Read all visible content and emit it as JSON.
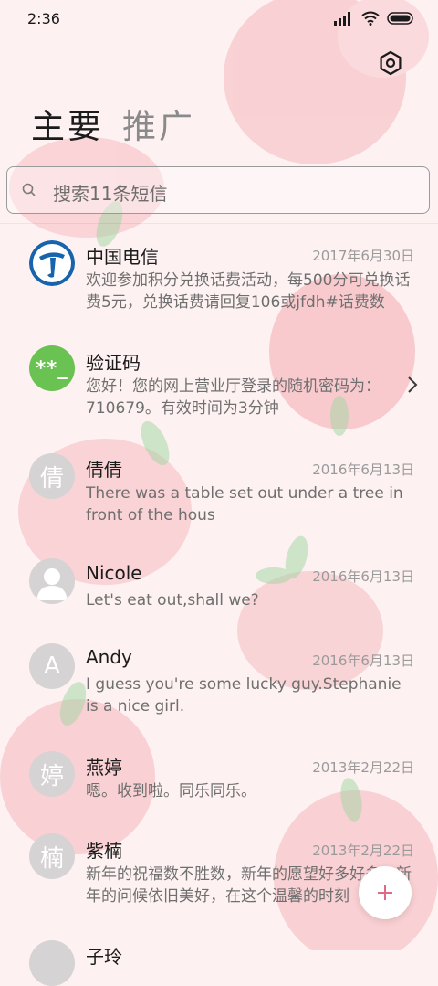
{
  "status": {
    "time": "2:36"
  },
  "tabs": [
    {
      "label": "主要",
      "active": true
    },
    {
      "label": "推广",
      "active": false
    }
  ],
  "search": {
    "placeholder": "搜索11条短信"
  },
  "conversations": [
    {
      "name": "中国电信",
      "date": "2017年6月30日",
      "preview": "欢迎参加积分兑换话费活动，每500分可兑换话费5元，兑换话费请回复106或jfdh#话费数",
      "avatar": "china-telecom-logo"
    },
    {
      "name": "验证码",
      "date": "",
      "preview": "您好！您的网上营业厅登录的随机密码为：710679。有效时间为3分钟",
      "avatar_text": "**_"
    },
    {
      "name": "倩倩",
      "date": "2016年6月13日",
      "preview": "There was a table set out under a tree in front of the hous",
      "avatar_text": "倩"
    },
    {
      "name": "Nicole",
      "date": "2016年6月13日",
      "preview": "Let's eat out,shall we?",
      "avatar": "person-icon"
    },
    {
      "name": "Andy",
      "date": "2016年6月13日",
      "preview": "I guess you're some lucky guy.Stephanie is a nice girl.",
      "avatar_text": "A"
    },
    {
      "name": "燕婷",
      "date": "2013年2月22日",
      "preview": "嗯。收到啦。同乐同乐。",
      "avatar_text": "婷"
    },
    {
      "name": "紫楠",
      "date": "2013年2月22日",
      "preview": "新年的祝福数不胜数，新年的愿望好多好多，新年的问候依旧美好，在这个温馨的时刻",
      "avatar_text": "楠"
    },
    {
      "name": "子玲",
      "date": "",
      "preview": "",
      "avatar_text": ""
    }
  ],
  "colors": {
    "accent": "#e06a86",
    "verification": "#6ac252",
    "peach": "#f5b3b8"
  }
}
